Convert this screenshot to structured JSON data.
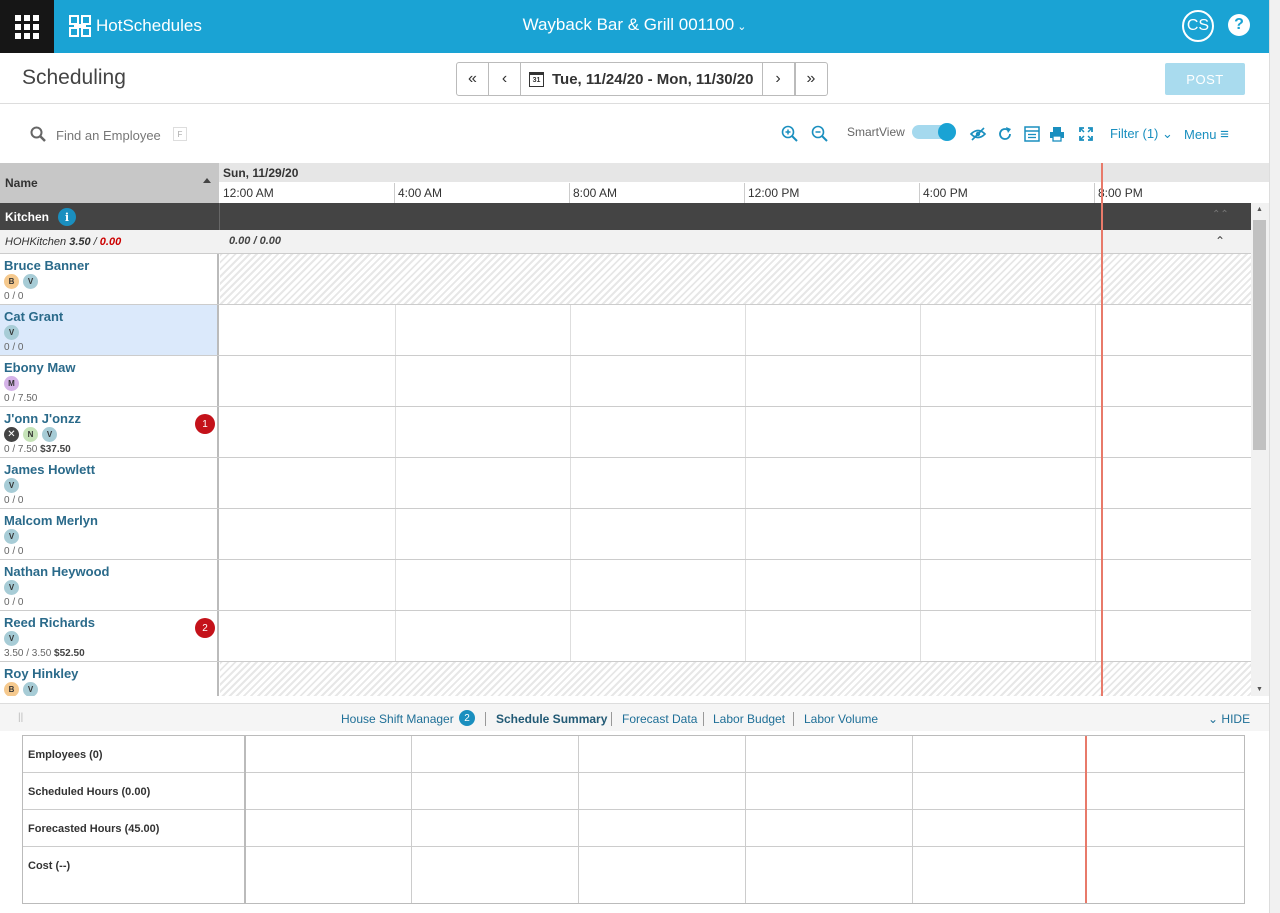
{
  "topbar": {
    "app_name": "HotSchedules",
    "store_name": "Wayback Bar & Grill 001100",
    "store_caret": "⌄",
    "avatar_initials": "CS",
    "help_label": "?"
  },
  "header": {
    "title": "Scheduling",
    "date_range": "Tue, 11/24/20 - Mon, 11/30/20",
    "calendar_day": "31",
    "post_label": "POST",
    "nav_first": "«",
    "nav_prev": "‹",
    "nav_next": "›",
    "nav_last": "»"
  },
  "toolbar": {
    "search_placeholder": "Find an Employee",
    "search_shortcut": "F",
    "smartview_label": "SmartView",
    "smartview_on": true,
    "filter_label": "Filter (1)",
    "menu_label": "Menu",
    "icons": [
      "zoom-in-icon",
      "zoom-out-icon",
      "hide-icon",
      "refresh-icon",
      "list-view-icon",
      "print-icon",
      "fullscreen-icon"
    ]
  },
  "grid": {
    "name_header": "Name",
    "day_label": "Sun, 11/29/20",
    "hours": [
      "12:00 AM",
      "4:00 AM",
      "8:00 AM",
      "12:00 PM",
      "4:00 PM",
      "8:00 PM"
    ],
    "department": {
      "name": "Kitchen",
      "info": "i"
    },
    "subgroup": {
      "name": "HOHKitchen",
      "scheduled": "3.50",
      "separator": " / ",
      "cost": "0.00",
      "timeline_values": "0.00 / 0.00"
    },
    "employees": [
      {
        "name": "Bruce Banner",
        "badges": [
          "B",
          "V"
        ],
        "hours": "0 / 0",
        "cost": "",
        "alert": "",
        "unavailable": true,
        "selected": false
      },
      {
        "name": "Cat Grant",
        "badges": [
          "V"
        ],
        "hours": "0 / 0",
        "cost": "",
        "alert": "",
        "unavailable": false,
        "selected": true
      },
      {
        "name": "Ebony Maw",
        "badges": [
          "M"
        ],
        "hours": "0 / 7.50",
        "cost": "",
        "alert": "",
        "unavailable": false,
        "selected": false
      },
      {
        "name": "J'onn J'onzz",
        "badges": [
          "X",
          "N",
          "V"
        ],
        "hours": "0 / 7.50",
        "cost": "$37.50",
        "alert": "1",
        "unavailable": false,
        "selected": false
      },
      {
        "name": "James Howlett",
        "badges": [
          "V"
        ],
        "hours": "0 / 0",
        "cost": "",
        "alert": "",
        "unavailable": false,
        "selected": false
      },
      {
        "name": "Malcom Merlyn",
        "badges": [
          "V"
        ],
        "hours": "0 / 0",
        "cost": "",
        "alert": "",
        "unavailable": false,
        "selected": false
      },
      {
        "name": "Nathan Heywood",
        "badges": [
          "V"
        ],
        "hours": "0 / 0",
        "cost": "",
        "alert": "",
        "unavailable": false,
        "selected": false
      },
      {
        "name": "Reed Richards",
        "badges": [
          "V"
        ],
        "hours": "3.50 / 3.50",
        "cost": "$52.50",
        "alert": "2",
        "unavailable": false,
        "selected": false
      },
      {
        "name": "Roy Hinkley",
        "badges": [
          "B",
          "V"
        ],
        "hours": "",
        "cost": "",
        "alert": "",
        "unavailable": true,
        "selected": false
      }
    ]
  },
  "bottom_panel": {
    "tabs": [
      {
        "label": "House Shift Manager",
        "badge": "2",
        "active": false
      },
      {
        "label": "Schedule Summary",
        "badge": "",
        "active": true
      },
      {
        "label": "Forecast Data",
        "badge": "",
        "active": false
      },
      {
        "label": "Labor Budget",
        "badge": "",
        "active": false
      },
      {
        "label": "Labor Volume",
        "badge": "",
        "active": false
      }
    ],
    "hide_label": "HIDE",
    "summary_rows": [
      "Employees (0)",
      "Scheduled Hours (0.00)",
      "Forecasted Hours (45.00)",
      "Cost (--)"
    ]
  },
  "colors": {
    "brand": "#1aa3d4",
    "alert": "#c4121a",
    "now_line": "#e87a6a",
    "department_bar": "#444444"
  }
}
